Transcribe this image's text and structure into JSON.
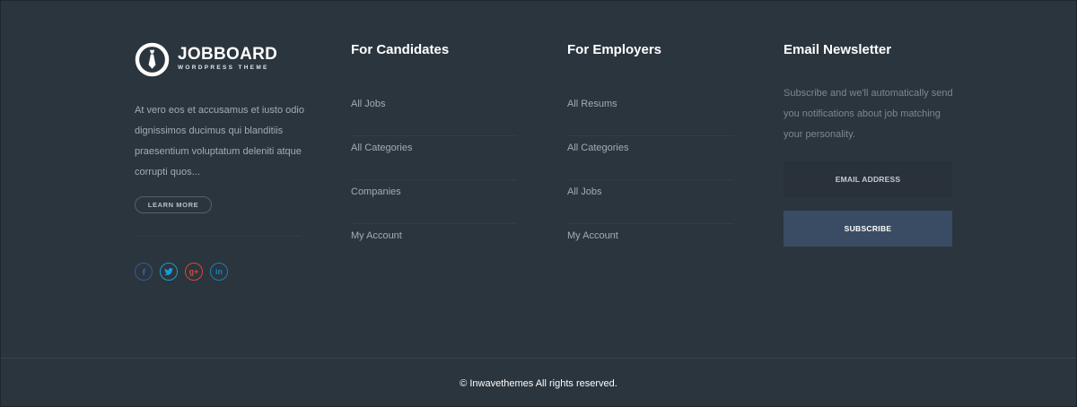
{
  "brand": {
    "title": "JOBBOARD",
    "subtitle": "WORDPRESS THEME",
    "description": "At vero eos et accusamus et iusto odio dignissimos ducimus qui blanditiis praesentium voluptatum deleniti atque corrupti quos...",
    "learn_more_label": "LEARN MORE"
  },
  "social": [
    {
      "icon": "facebook-icon",
      "glyph": "f",
      "color": "#3b5998"
    },
    {
      "icon": "twitter-icon",
      "glyph": "t",
      "color": "#1da1f2"
    },
    {
      "icon": "google-plus-icon",
      "glyph": "g+",
      "color": "#dd4b39"
    },
    {
      "icon": "linkedin-icon",
      "glyph": "in",
      "color": "#0e76a8"
    }
  ],
  "candidates": {
    "title": "For Candidates",
    "links": [
      "All Jobs",
      "All Categories",
      "Companies",
      "My Account"
    ]
  },
  "employers": {
    "title": "For Employers",
    "links": [
      "All Resums",
      "All Categories",
      "All Jobs",
      "My Account"
    ]
  },
  "newsletter": {
    "title": "Email Newsletter",
    "text": "Subscribe and we'll automatically send you notifications about job matching your personality.",
    "email_placeholder": "EMAIL ADDRESS",
    "subscribe_label": "SUBSCRIBE"
  },
  "footer": {
    "copyright": "© Inwavethemes All rights reserved."
  },
  "colors": {
    "background": "#2b353d",
    "subscribe_button": "#3a4c63"
  }
}
